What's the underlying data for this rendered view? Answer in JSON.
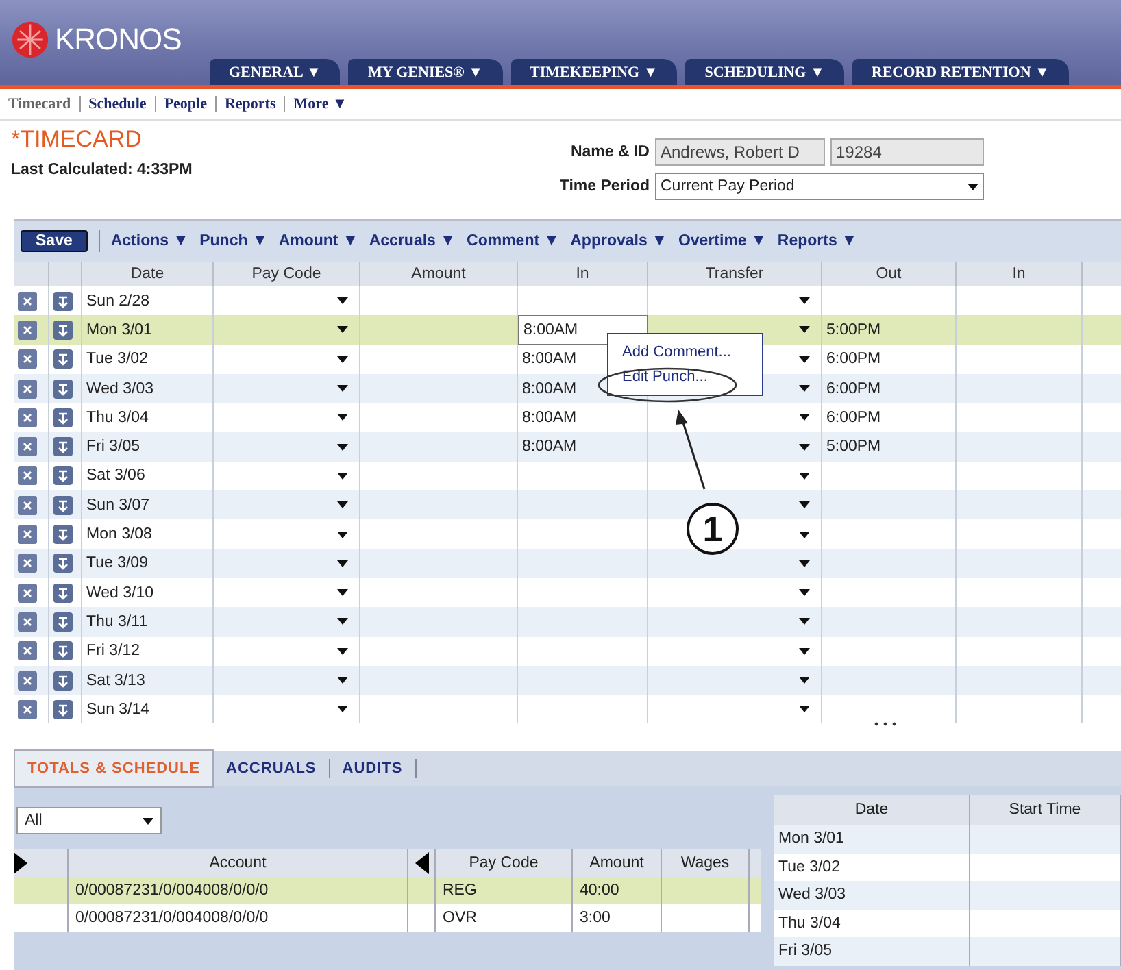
{
  "brand": {
    "name": "KRONOS"
  },
  "main_tabs": [
    {
      "label": "GENERAL ▼"
    },
    {
      "label": "MY GENIES® ▼"
    },
    {
      "label": "TIMEKEEPING ▼"
    },
    {
      "label": "SCHEDULING ▼"
    },
    {
      "label": "RECORD RETENTION ▼"
    }
  ],
  "sub_nav": [
    {
      "label": "Timecard",
      "selected": true
    },
    {
      "label": "Schedule",
      "selected": false
    },
    {
      "label": "People",
      "selected": false
    },
    {
      "label": "Reports",
      "selected": false
    },
    {
      "label": "More ▼",
      "selected": false
    }
  ],
  "page": {
    "title": "*TIMECARD",
    "last_calculated": "Last Calculated: 4:33PM",
    "name_label": "Name & ID",
    "name_value": "Andrews, Robert D",
    "id_value": "19284",
    "period_label": "Time Period",
    "period_value": "Current Pay Period"
  },
  "toolbar": {
    "save": "Save",
    "menus": [
      "Actions ▼",
      "Punch ▼",
      "Amount ▼",
      "Accruals ▼",
      "Comment ▼",
      "Approvals ▼",
      "Overtime ▼",
      "Reports ▼"
    ]
  },
  "grid": {
    "columns": [
      "Date",
      "Pay Code",
      "Amount",
      "In",
      "Transfer",
      "Out",
      "In"
    ],
    "rows": [
      {
        "date": "Sun 2/28",
        "in": "",
        "out": "",
        "selected": false
      },
      {
        "date": "Mon 3/01",
        "in": "8:00AM",
        "out": "5:00PM",
        "selected": true
      },
      {
        "date": "Tue 3/02",
        "in": "8:00AM",
        "out": "6:00PM",
        "selected": false
      },
      {
        "date": "Wed 3/03",
        "in": "8:00AM",
        "out": "6:00PM",
        "selected": false
      },
      {
        "date": "Thu 3/04",
        "in": "8:00AM",
        "out": "6:00PM",
        "selected": false
      },
      {
        "date": "Fri 3/05",
        "in": "8:00AM",
        "out": "5:00PM",
        "selected": false
      },
      {
        "date": "Sat 3/06",
        "in": "",
        "out": "",
        "selected": false
      },
      {
        "date": "Sun 3/07",
        "in": "",
        "out": "",
        "selected": false
      },
      {
        "date": "Mon 3/08",
        "in": "",
        "out": "",
        "selected": false
      },
      {
        "date": "Tue 3/09",
        "in": "",
        "out": "",
        "selected": false
      },
      {
        "date": "Wed 3/10",
        "in": "",
        "out": "",
        "selected": false
      },
      {
        "date": "Thu 3/11",
        "in": "",
        "out": "",
        "selected": false
      },
      {
        "date": "Fri 3/12",
        "in": "",
        "out": "",
        "selected": false
      },
      {
        "date": "Sat 3/13",
        "in": "",
        "out": "",
        "selected": false
      },
      {
        "date": "Sun 3/14",
        "in": "",
        "out": "",
        "selected": false
      }
    ]
  },
  "context_menu": {
    "items": [
      "Add Comment...",
      "Edit Punch..."
    ]
  },
  "callout": {
    "number": "1"
  },
  "bottom_tabs": [
    {
      "label": "TOTALS & SCHEDULE",
      "selected": true
    },
    {
      "label": "ACCRUALS",
      "selected": false
    },
    {
      "label": "AUDITS",
      "selected": false
    }
  ],
  "totals": {
    "filter": "All",
    "columns": [
      "Account",
      "Pay Code",
      "Amount",
      "Wages"
    ],
    "rows": [
      {
        "account": "0/00087231/0/004008/0/0/0",
        "pay_code": "REG",
        "amount": "40:00",
        "wages": "",
        "selected": true
      },
      {
        "account": "0/00087231/0/004008/0/0/0",
        "pay_code": "OVR",
        "amount": "3:00",
        "wages": "",
        "selected": false
      }
    ]
  },
  "schedule": {
    "columns": [
      "Date",
      "Start Time"
    ],
    "rows": [
      "Mon 3/01",
      "Tue 3/02",
      "Wed 3/03",
      "Thu 3/04",
      "Fri 3/05"
    ]
  }
}
